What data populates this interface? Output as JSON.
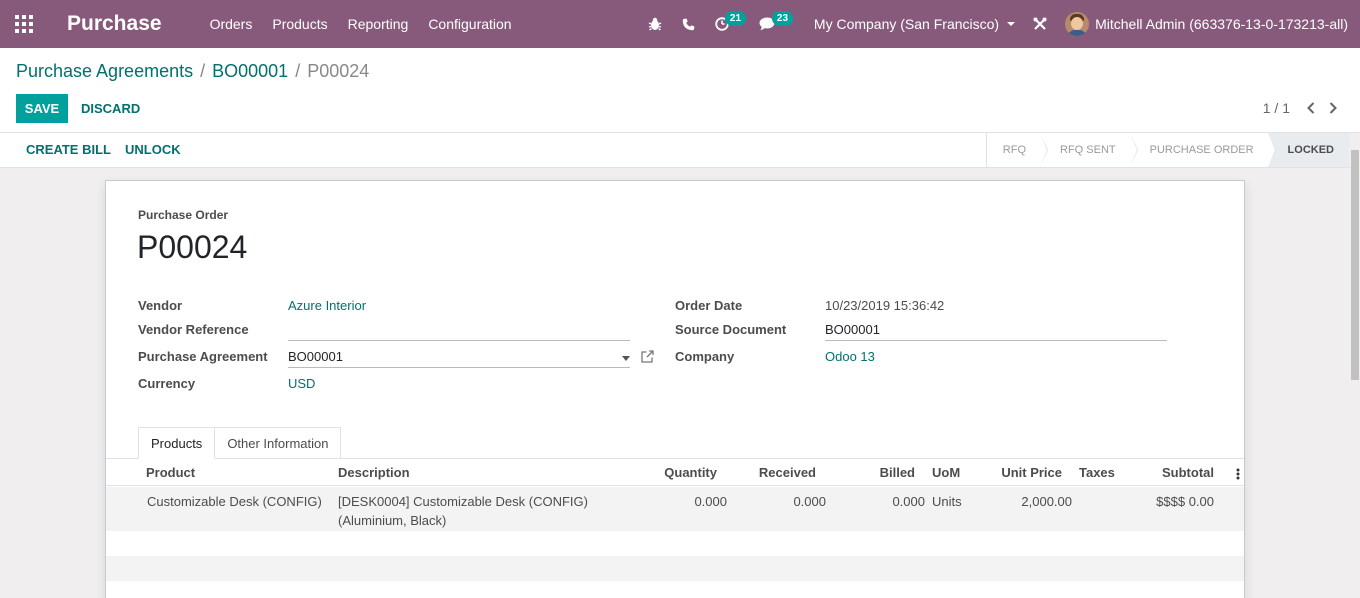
{
  "app": {
    "title": "Purchase",
    "menu": [
      "Orders",
      "Products",
      "Reporting",
      "Configuration"
    ],
    "activity_count": "21",
    "message_count": "23",
    "company": "My Company (San Francisco)",
    "user": "Mitchell Admin (663376-13-0-173213-all)"
  },
  "breadcrumb": {
    "items": [
      "Purchase Agreements",
      "BO00001"
    ],
    "current": "P00024",
    "separator": "/"
  },
  "buttons": {
    "save": "SAVE",
    "discard": "DISCARD",
    "create_bill": "CREATE BILL",
    "unlock": "UNLOCK"
  },
  "pager": {
    "value": "1 / 1"
  },
  "stages": [
    {
      "label": "RFQ",
      "active": false
    },
    {
      "label": "RFQ SENT",
      "active": false
    },
    {
      "label": "PURCHASE ORDER",
      "active": false
    },
    {
      "label": "LOCKED",
      "active": true
    }
  ],
  "form": {
    "doc_label": "Purchase Order",
    "doc_name": "P00024",
    "left_fields": {
      "vendor_label": "Vendor",
      "vendor_value": "Azure Interior",
      "vendor_ref_label": "Vendor Reference",
      "vendor_ref_value": "",
      "agreement_label": "Purchase Agreement",
      "agreement_value": "BO00001",
      "currency_label": "Currency",
      "currency_value": "USD"
    },
    "right_fields": {
      "order_date_label": "Order Date",
      "order_date_value": "10/23/2019 15:36:42",
      "source_label": "Source Document",
      "source_value": "BO00001",
      "company_label": "Company",
      "company_value": "Odoo 13"
    }
  },
  "tabs": [
    "Products",
    "Other Information"
  ],
  "table": {
    "columns": [
      "Product",
      "Description",
      "Quantity",
      "Received",
      "Billed",
      "UoM",
      "Unit Price",
      "Taxes",
      "Subtotal"
    ],
    "rows": [
      {
        "product": "Customizable Desk (CONFIG)",
        "description_line1": "[DESK0004] Customizable Desk (CONFIG)",
        "description_line2": "(Aluminium, Black)",
        "quantity": "0.000",
        "received": "0.000",
        "billed": "0.000",
        "uom": "Units",
        "unit_price": "2,000.00",
        "taxes": "",
        "subtotal": "$$$$ 0.00"
      }
    ]
  },
  "colors": {
    "navbar": "#875a7b",
    "primary": "#00a09d",
    "link": "#00716e"
  }
}
